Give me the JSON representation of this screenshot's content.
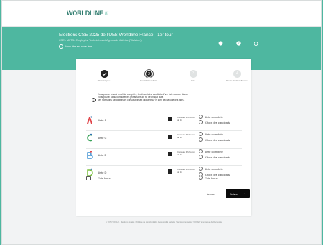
{
  "header": {
    "logo_text": "WORLDLINE",
    "logo_mark": "///"
  },
  "banner": {
    "title": "Elections CSE 2025 de l'UES Worldline France - 1er tour",
    "subtitle": "CSE - MiITS - Employés, Techniciens et Agents de Maîtrise (Titulaires)",
    "help_link": "Vous êtes en mode liste",
    "icons": [
      "shield-icon",
      "help-icon",
      "power-icon"
    ]
  },
  "stepper": {
    "steps": [
      {
        "label": "Circonscription",
        "state": "done"
      },
      {
        "label": "Constitution bulletin",
        "state": "active",
        "number": "2"
      },
      {
        "label": "Vote",
        "state": "todo",
        "number": "3"
      },
      {
        "label": "Preuve de dépouillement",
        "state": "todo",
        "number": "4"
      }
    ]
  },
  "info": {
    "line1": "Vous pouvez choisir une liste complète, choisir certains candidats d'une liste ou voter blanc.",
    "line2": "Vous pouvez aussi consulter les professions de foi de chaque liste.",
    "line3": "Les noms des candidats sont consultables en cliquant sur le nom de chacune des listes."
  },
  "lists": [
    {
      "name": "Liste A",
      "icon": "cfdt-logo-icon",
      "color": "#e0454a",
      "doc": "Consulter Profession de foi",
      "opt1": "Liste complète",
      "opt2": "Choix des candidats"
    },
    {
      "name": "Liste C",
      "icon": "cgc-logo-icon",
      "color": "#3aa35a",
      "doc": "Consulter Profession de foi",
      "opt1": "Liste complète",
      "opt2": "Choix des candidats"
    },
    {
      "name": "Liste B",
      "icon": "cftc-logo-icon",
      "color": "#3b8fd1",
      "doc": "Consulter Profession de foi",
      "opt1": "Liste complète",
      "opt2": "Choix des candidats"
    },
    {
      "name": "Liste D",
      "icon": "unsa-logo-icon",
      "color": "#7abf3e",
      "doc": "Consulter Profession de foi",
      "opt1": "Liste complète",
      "opt2": "Choix des candidats"
    }
  ],
  "blank_vote": {
    "name": "Vote blanc",
    "option": "Vote blanc"
  },
  "actions": {
    "back": "Annuler",
    "next": "Suivre"
  },
  "footer": {
    "text": "© 2025 VOXALY · Mentions légales · Politique de confidentialité · Accessibilité partielle · Service proposé par VOXALY une marque de Docaposte"
  },
  "colors": {
    "brand": "#4eb7a0",
    "primary_button": "#0b0b0b"
  }
}
